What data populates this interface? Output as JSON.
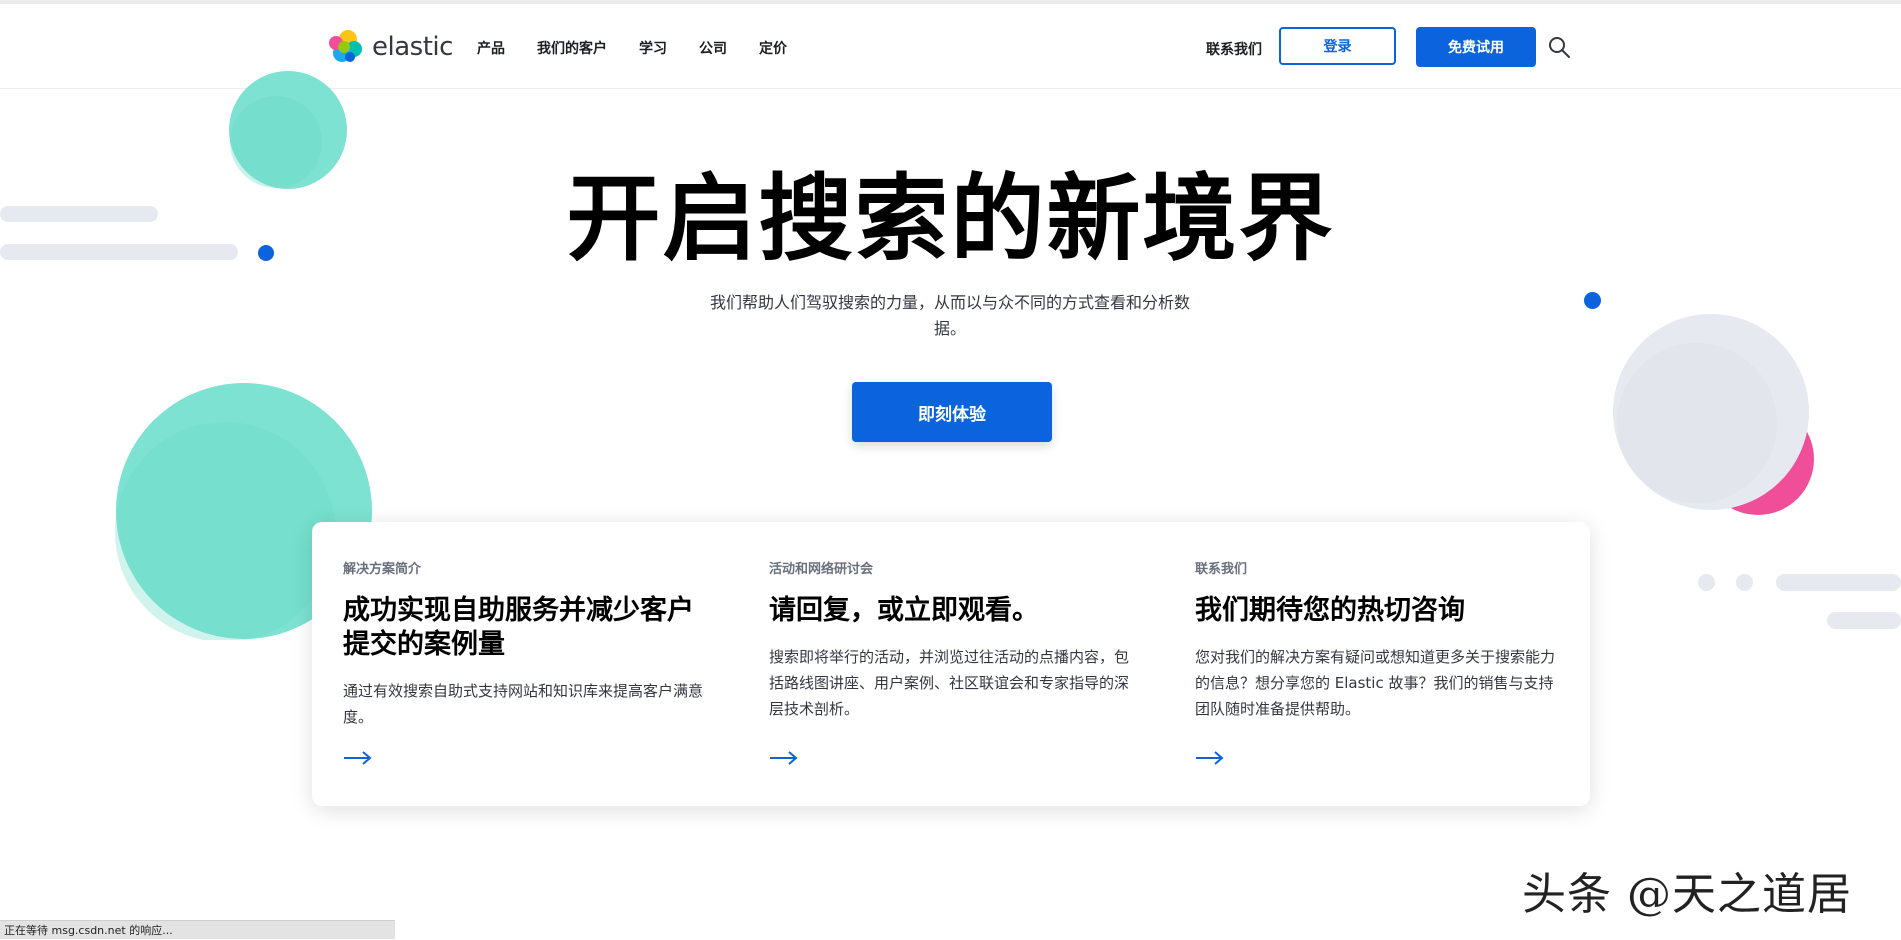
{
  "header": {
    "logo_text": "elastic",
    "nav": [
      "产品",
      "我们的客户",
      "学习",
      "公司",
      "定价"
    ],
    "contact_label": "联系我们",
    "login_label": "登录",
    "trial_label": "免费试用",
    "search_icon": "search-icon"
  },
  "hero": {
    "title": "开启搜索的新境界",
    "subtitle": "我们帮助人们驾驭搜索的力量，从而以与众不同的方式查看和分析数据。",
    "cta_label": "即刻体验"
  },
  "cards": [
    {
      "eyebrow": "解决方案简介",
      "title": "成功实现自助服务并减少客户提交的案例量",
      "text": "通过有效搜索自助式支持网站和知识库来提高客户满意度。"
    },
    {
      "eyebrow": "活动和网络研讨会",
      "title": "请回复，或立即观看。",
      "text": "搜索即将举行的活动，并浏览过往活动的点播内容，包括路线图讲座、用户案例、社区联谊会和专家指导的深层技术剖析。"
    },
    {
      "eyebrow": "联系我们",
      "title": "我们期待您的热切咨询",
      "text": "您对我们的解决方案有疑问或想知道更多关于搜索能力的信息？想分享您的 Elastic 故事？我们的销售与支持团队随时准备提供帮助。"
    }
  ],
  "status_bar": "正在等待 msg.csdn.net 的响应...",
  "watermark": "头条 @天之道居",
  "colors": {
    "brand_blue": "#0b64dd",
    "teal": "#7de2d1",
    "pink": "#f04e98",
    "light_gray": "#e6e9ef"
  }
}
